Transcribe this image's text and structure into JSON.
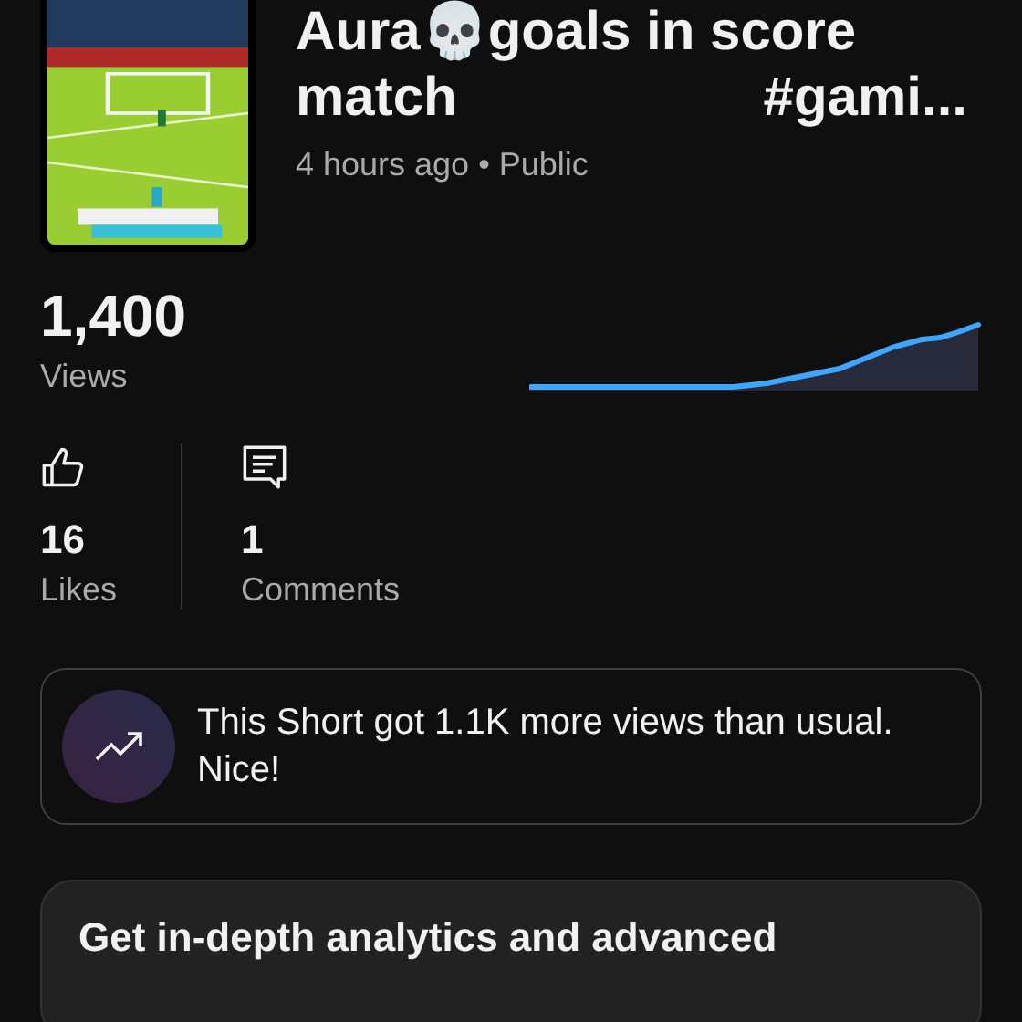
{
  "video": {
    "title_lines": [
      "Aura💀goals in score",
      "match",
      "#gami..."
    ],
    "meta": "4 hours ago • Public"
  },
  "views": {
    "count": "1,400",
    "label": "Views"
  },
  "stats": [
    {
      "kind": "likes",
      "count": "16",
      "label": "Likes"
    },
    {
      "kind": "comments",
      "count": "1",
      "label": "Comments"
    }
  ],
  "insight": {
    "text": "This Short got 1.1K more views than usual. Nice!"
  },
  "promo": {
    "text": "Get in-depth analytics and advanced"
  }
}
